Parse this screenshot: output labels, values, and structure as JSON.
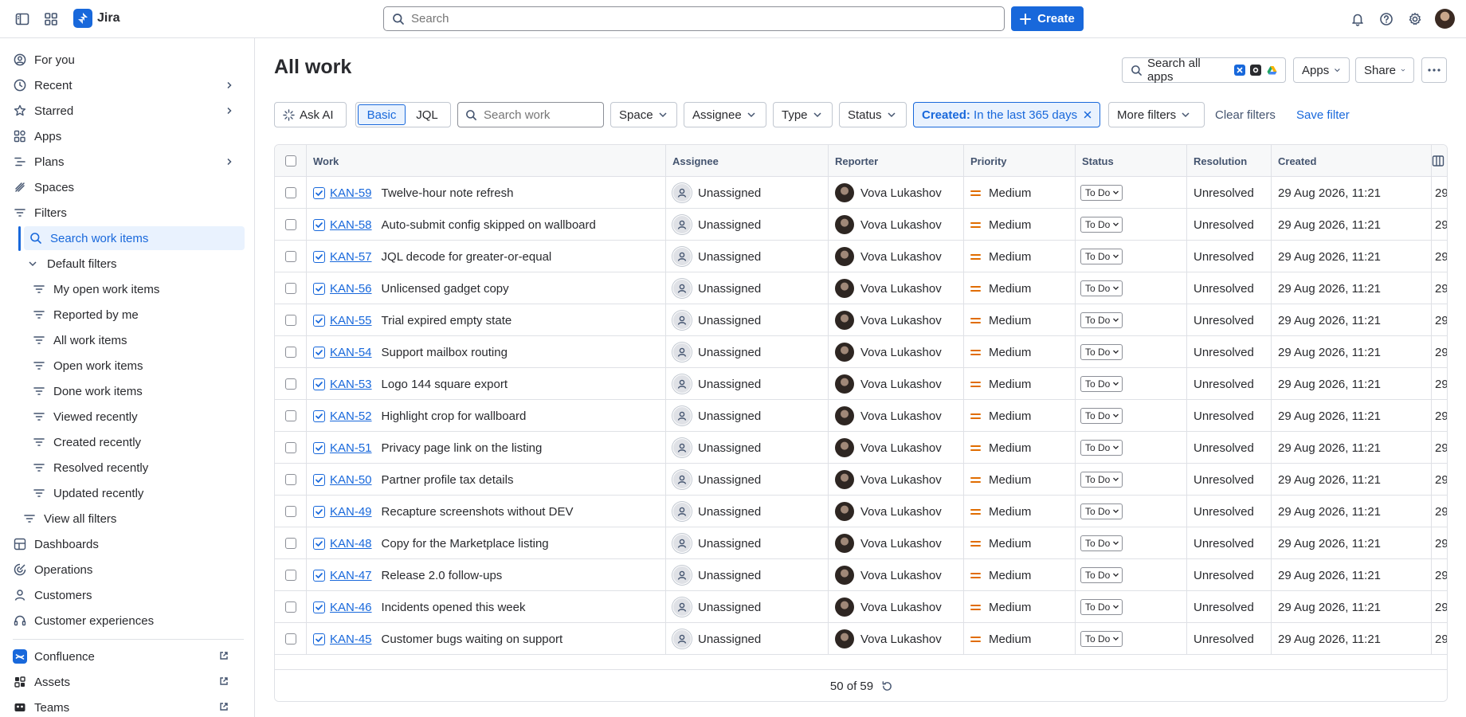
{
  "topbar": {
    "app_name": "Jira",
    "search_placeholder": "Search",
    "create_label": "Create"
  },
  "sidebar": {
    "items": [
      {
        "label": "For you"
      },
      {
        "label": "Recent"
      },
      {
        "label": "Starred"
      },
      {
        "label": "Apps"
      },
      {
        "label": "Plans"
      },
      {
        "label": "Spaces"
      },
      {
        "label": "Filters"
      },
      {
        "label": "Search work items"
      },
      {
        "label": "Default filters"
      },
      {
        "label": "My open work items"
      },
      {
        "label": "Reported by me"
      },
      {
        "label": "All work items"
      },
      {
        "label": "Open work items"
      },
      {
        "label": "Done work items"
      },
      {
        "label": "Viewed recently"
      },
      {
        "label": "Created recently"
      },
      {
        "label": "Resolved recently"
      },
      {
        "label": "Updated recently"
      },
      {
        "label": "View all filters"
      },
      {
        "label": "Dashboards"
      },
      {
        "label": "Operations"
      },
      {
        "label": "Customers"
      },
      {
        "label": "Customer experiences"
      },
      {
        "label": "Confluence"
      },
      {
        "label": "Assets"
      },
      {
        "label": "Teams"
      }
    ]
  },
  "header": {
    "title": "All work",
    "search_all_apps": "Search all apps",
    "apps_label": "Apps",
    "share_label": "Share"
  },
  "filters": {
    "ask_ai": "Ask AI",
    "basic": "Basic",
    "jql": "JQL",
    "search_placeholder": "Search work",
    "space": "Space",
    "assignee": "Assignee",
    "type": "Type",
    "status": "Status",
    "created_key": "Created:",
    "created_value": "In the last 365 days",
    "more_filters": "More filters",
    "clear_filters": "Clear filters",
    "save_filter": "Save filter"
  },
  "table": {
    "columns": [
      "Work",
      "Assignee",
      "Reporter",
      "Priority",
      "Status",
      "Resolution",
      "Created"
    ],
    "rows": [
      {
        "key": "KAN-59",
        "summary": "Twelve-hour note refresh",
        "assignee": "Unassigned",
        "reporter": "Vova Lukashov",
        "priority": "Medium",
        "status": "To Do",
        "resolution": "Unresolved",
        "created": "29 Aug 2026, 11:21",
        "updated": "29"
      },
      {
        "key": "KAN-58",
        "summary": "Auto-submit config skipped on wallboard",
        "assignee": "Unassigned",
        "reporter": "Vova Lukashov",
        "priority": "Medium",
        "status": "To Do",
        "resolution": "Unresolved",
        "created": "29 Aug 2026, 11:21",
        "updated": "29"
      },
      {
        "key": "KAN-57",
        "summary": "JQL decode for greater-or-equal",
        "assignee": "Unassigned",
        "reporter": "Vova Lukashov",
        "priority": "Medium",
        "status": "To Do",
        "resolution": "Unresolved",
        "created": "29 Aug 2026, 11:21",
        "updated": "29"
      },
      {
        "key": "KAN-56",
        "summary": "Unlicensed gadget copy",
        "assignee": "Unassigned",
        "reporter": "Vova Lukashov",
        "priority": "Medium",
        "status": "To Do",
        "resolution": "Unresolved",
        "created": "29 Aug 2026, 11:21",
        "updated": "29"
      },
      {
        "key": "KAN-55",
        "summary": "Trial expired empty state",
        "assignee": "Unassigned",
        "reporter": "Vova Lukashov",
        "priority": "Medium",
        "status": "To Do",
        "resolution": "Unresolved",
        "created": "29 Aug 2026, 11:21",
        "updated": "29"
      },
      {
        "key": "KAN-54",
        "summary": "Support mailbox routing",
        "assignee": "Unassigned",
        "reporter": "Vova Lukashov",
        "priority": "Medium",
        "status": "To Do",
        "resolution": "Unresolved",
        "created": "29 Aug 2026, 11:21",
        "updated": "29"
      },
      {
        "key": "KAN-53",
        "summary": "Logo 144 square export",
        "assignee": "Unassigned",
        "reporter": "Vova Lukashov",
        "priority": "Medium",
        "status": "To Do",
        "resolution": "Unresolved",
        "created": "29 Aug 2026, 11:21",
        "updated": "29"
      },
      {
        "key": "KAN-52",
        "summary": "Highlight crop for wallboard",
        "assignee": "Unassigned",
        "reporter": "Vova Lukashov",
        "priority": "Medium",
        "status": "To Do",
        "resolution": "Unresolved",
        "created": "29 Aug 2026, 11:21",
        "updated": "29"
      },
      {
        "key": "KAN-51",
        "summary": "Privacy page link on the listing",
        "assignee": "Unassigned",
        "reporter": "Vova Lukashov",
        "priority": "Medium",
        "status": "To Do",
        "resolution": "Unresolved",
        "created": "29 Aug 2026, 11:21",
        "updated": "29"
      },
      {
        "key": "KAN-50",
        "summary": "Partner profile tax details",
        "assignee": "Unassigned",
        "reporter": "Vova Lukashov",
        "priority": "Medium",
        "status": "To Do",
        "resolution": "Unresolved",
        "created": "29 Aug 2026, 11:21",
        "updated": "29"
      },
      {
        "key": "KAN-49",
        "summary": "Recapture screenshots without DEV",
        "assignee": "Unassigned",
        "reporter": "Vova Lukashov",
        "priority": "Medium",
        "status": "To Do",
        "resolution": "Unresolved",
        "created": "29 Aug 2026, 11:21",
        "updated": "29"
      },
      {
        "key": "KAN-48",
        "summary": "Copy for the Marketplace listing",
        "assignee": "Unassigned",
        "reporter": "Vova Lukashov",
        "priority": "Medium",
        "status": "To Do",
        "resolution": "Unresolved",
        "created": "29 Aug 2026, 11:21",
        "updated": "29"
      },
      {
        "key": "KAN-47",
        "summary": "Release 2.0 follow-ups",
        "assignee": "Unassigned",
        "reporter": "Vova Lukashov",
        "priority": "Medium",
        "status": "To Do",
        "resolution": "Unresolved",
        "created": "29 Aug 2026, 11:21",
        "updated": "29"
      },
      {
        "key": "KAN-46",
        "summary": "Incidents opened this week",
        "assignee": "Unassigned",
        "reporter": "Vova Lukashov",
        "priority": "Medium",
        "status": "To Do",
        "resolution": "Unresolved",
        "created": "29 Aug 2026, 11:21",
        "updated": "29"
      },
      {
        "key": "KAN-45",
        "summary": "Customer bugs waiting on support",
        "assignee": "Unassigned",
        "reporter": "Vova Lukashov",
        "priority": "Medium",
        "status": "To Do",
        "resolution": "Unresolved",
        "created": "29 Aug 2026, 11:21",
        "updated": "29"
      }
    ],
    "pagination": "50 of 59"
  },
  "colors": {
    "accent": "#1868db",
    "accent_bg": "#e9f2fe",
    "priority_medium": "#e06c00",
    "border": "#dfe1e6"
  },
  "icons": {
    "sidebar_toggle": "sidebar-toggle-icon",
    "app_switcher": "app-switcher-icon",
    "notifications": "bell-icon",
    "help": "help-icon",
    "settings": "gear-icon"
  }
}
